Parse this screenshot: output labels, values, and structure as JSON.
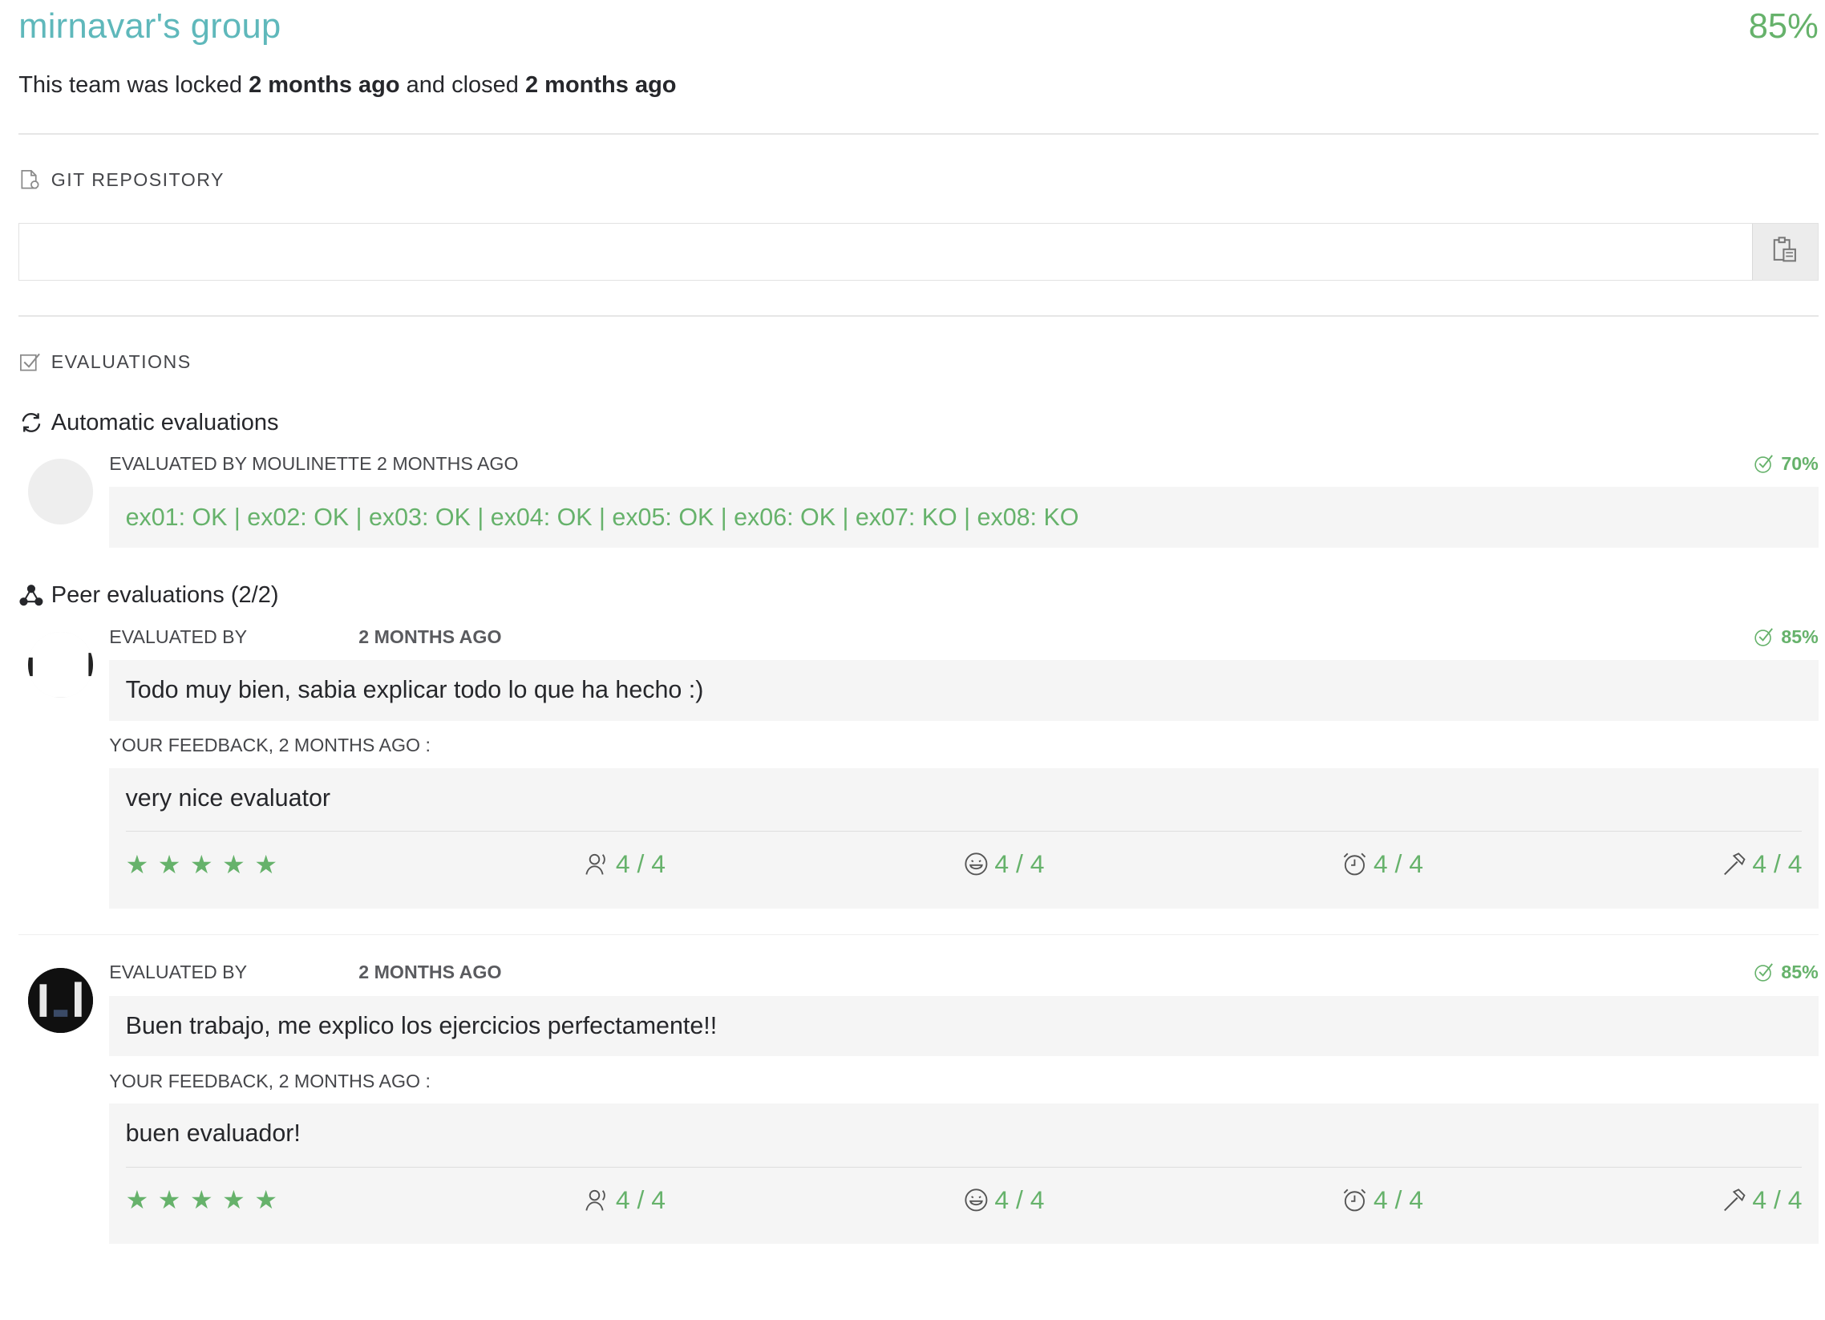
{
  "header": {
    "title": "mirnavar's group",
    "grade": "85%",
    "status_prefix": "This team was locked",
    "locked_ago": "2 months ago",
    "status_middle": "and closed",
    "closed_ago": "2 months ago"
  },
  "git": {
    "section_title": "GIT REPOSITORY",
    "url": "",
    "icons": {
      "section": "file-icon",
      "copy": "clipboard-icon"
    }
  },
  "evaluations": {
    "section_title": "EVALUATIONS",
    "automatic": {
      "title": "Automatic evaluations",
      "evaluated_by": "EVALUATED BY MOULINETTE 2 MONTHS AGO",
      "score": "70%",
      "result": "ex01: OK | ex02: OK | ex03: OK | ex04: OK | ex05: OK | ex06: OK | ex07: KO | ex08: KO"
    },
    "peer_title": "Peer evaluations (2/2)",
    "peers": [
      {
        "evaluated_by_label": "EVALUATED BY",
        "ago": "2 MONTHS AGO",
        "score": "85%",
        "comment": "Todo muy bien, sabia explicar todo lo que ha hecho :)",
        "feedback_label": "YOUR FEEDBACK, 2 MONTHS AGO :",
        "feedback": "very nice evaluator",
        "stars": 5,
        "ratings": [
          "4 / 4",
          "4 / 4",
          "4 / 4",
          "4 / 4"
        ]
      },
      {
        "evaluated_by_label": "EVALUATED BY",
        "ago": "2 MONTHS AGO",
        "score": "85%",
        "comment": "Buen trabajo, me explico los ejercicios perfectamente!!",
        "feedback_label": "YOUR FEEDBACK, 2 MONTHS AGO :",
        "feedback": "buen evaluador!",
        "stars": 5,
        "ratings": [
          "4 / 4",
          "4 / 4",
          "4 / 4",
          "4 / 4"
        ]
      }
    ]
  },
  "colors": {
    "title": "#5fb8bb",
    "accent": "#66b26b",
    "panel": "#f5f5f5"
  }
}
